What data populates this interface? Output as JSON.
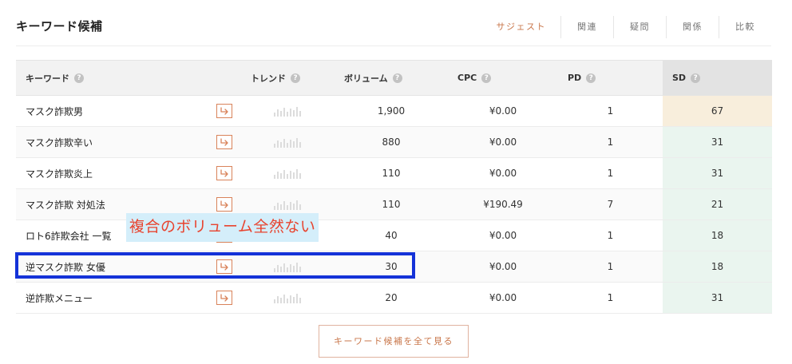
{
  "header": {
    "title": "キーワード候補",
    "tabs": [
      "サジェスト",
      "関連",
      "疑問",
      "関係",
      "比較"
    ]
  },
  "columns": {
    "keyword": "キーワード",
    "trend": "トレンド",
    "volume": "ボリューム",
    "cpc": "CPC",
    "pd": "PD",
    "sd": "SD"
  },
  "rows": [
    {
      "keyword": "マスク詐欺男",
      "volume": "1,900",
      "cpc": "¥0.00",
      "pd": "1",
      "sd": "67"
    },
    {
      "keyword": "マスク詐欺辛い",
      "volume": "880",
      "cpc": "¥0.00",
      "pd": "1",
      "sd": "31"
    },
    {
      "keyword": "マスク詐欺炎上",
      "volume": "110",
      "cpc": "¥0.00",
      "pd": "1",
      "sd": "31"
    },
    {
      "keyword": "マスク詐欺 対処法",
      "volume": "110",
      "cpc": "¥190.49",
      "pd": "7",
      "sd": "21"
    },
    {
      "keyword": "ロト6詐欺会社 一覧",
      "volume": "40",
      "cpc": "¥0.00",
      "pd": "1",
      "sd": "18"
    },
    {
      "keyword": "逆マスク詐欺 女優",
      "volume": "30",
      "cpc": "¥0.00",
      "pd": "1",
      "sd": "18"
    },
    {
      "keyword": "逆詐欺メニュー",
      "volume": "20",
      "cpc": "¥0.00",
      "pd": "1",
      "sd": "31"
    }
  ],
  "annotation": "複合のボリューム全然ない",
  "more_button": "キーワード候補を全て見る",
  "colors": {
    "accent": "#c9774b",
    "sd_high": "#f8eedc",
    "sd_low": "#eaf5ef",
    "highlight_border": "#1432d8",
    "annotation_text": "#e8442f",
    "annotation_bg": "#d4eefa"
  },
  "icons": {
    "row_action": "redirect-arrow-icon",
    "help": "help-icon",
    "trend": "trend-sparkline-icon"
  }
}
